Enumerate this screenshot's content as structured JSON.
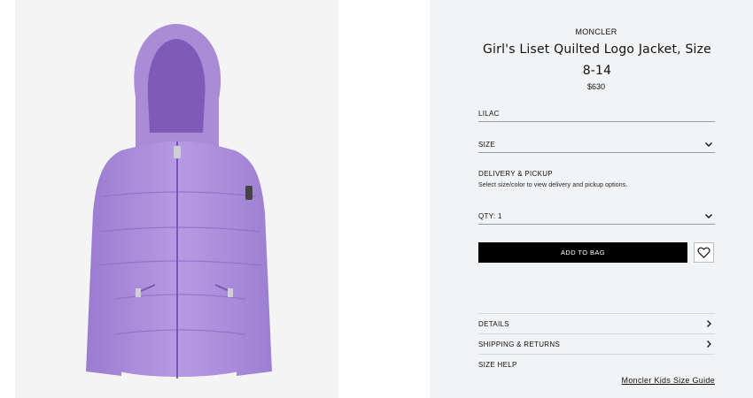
{
  "product": {
    "brand": "MONCLER",
    "title": "Girl's Liset Quilted Logo Jacket, Size 8-14",
    "price": "$630",
    "image_alt": "Lilac quilted hooded puffer jacket",
    "jacket_color": "#a98bd6"
  },
  "options": {
    "color_label": "LILAC",
    "size_label": "SIZE",
    "qty_label": "QTY: 1"
  },
  "delivery": {
    "title": "DELIVERY & PICKUP",
    "text": "Select size/color to view delivery and pickup options."
  },
  "actions": {
    "add_to_bag": "ADD TO BAG",
    "wishlist_icon": "heart-icon"
  },
  "accordion": {
    "details": "DETAILS",
    "shipping": "SHIPPING & RETURNS",
    "size_help": "SIZE HELP",
    "size_guide_link": "Moncler Kids Size Guide"
  }
}
